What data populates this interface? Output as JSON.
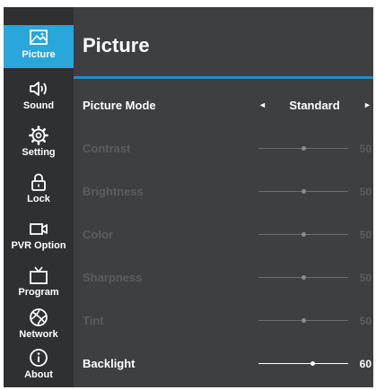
{
  "sidebar": {
    "items": [
      {
        "label": "Picture",
        "icon": "picture-icon",
        "active": true
      },
      {
        "label": "Sound",
        "icon": "speaker-icon",
        "active": false
      },
      {
        "label": "Setting",
        "icon": "gear-icon",
        "active": false
      },
      {
        "label": "Lock",
        "icon": "lock-icon",
        "active": false
      },
      {
        "label": "PVR Option",
        "icon": "video-camera-icon",
        "active": false
      },
      {
        "label": "Program",
        "icon": "tv-icon",
        "active": false
      },
      {
        "label": "Network",
        "icon": "globe-icon",
        "active": false
      },
      {
        "label": "About",
        "icon": "info-icon",
        "active": false
      }
    ]
  },
  "header": {
    "title": "Picture"
  },
  "settings": {
    "picture_mode": {
      "label": "Picture Mode",
      "value": "Standard",
      "left_arrow": "◄",
      "right_arrow": "►"
    },
    "sliders": [
      {
        "label": "Contrast",
        "value": "50",
        "level": 50,
        "enabled": false
      },
      {
        "label": "Brightness",
        "value": "50",
        "level": 50,
        "enabled": false
      },
      {
        "label": "Color",
        "value": "50",
        "level": 50,
        "enabled": false
      },
      {
        "label": "Sharpness",
        "value": "50",
        "level": 50,
        "enabled": false
      },
      {
        "label": "Tint",
        "value": "50",
        "level": 50,
        "enabled": false
      },
      {
        "label": "Backlight",
        "value": "60",
        "level": 60,
        "enabled": true
      }
    ]
  },
  "colors": {
    "accent": "#29a6da",
    "sidebar_bg": "#2e3032",
    "content_bg": "#3d3f41",
    "divider": "#1f8fc6",
    "disabled_text": "#5b5d5f"
  }
}
